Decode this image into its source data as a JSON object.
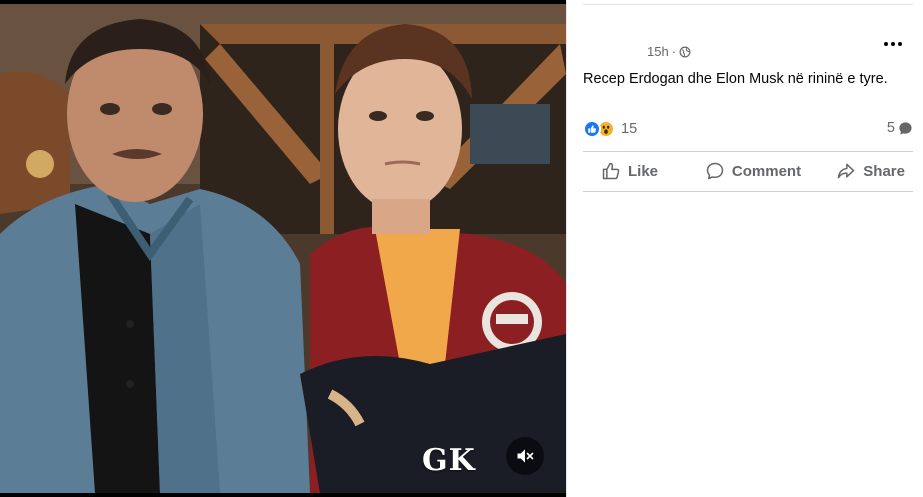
{
  "post": {
    "timestamp": "15h",
    "separator": "·",
    "privacy_icon": "globe-icon",
    "caption": "Recep Erdogan dhe Elon Musk në rininë e tyre.",
    "more_icon": "more-options-icon"
  },
  "media": {
    "watermark": "GK",
    "mute_icon": "speaker-muted-icon"
  },
  "reactions": {
    "icons": [
      "like-reaction-icon",
      "wow-reaction-icon"
    ],
    "count": "15",
    "comments_count": "5",
    "comments_icon": "comment-bubble-icon"
  },
  "actions": {
    "like_label": "Like",
    "comment_label": "Comment",
    "share_label": "Share"
  },
  "colors": {
    "facebook_blue": "#1877f2",
    "wow_yellow": "#f7b125",
    "secondary_text": "#65676b",
    "divider": "#ced0d4"
  }
}
